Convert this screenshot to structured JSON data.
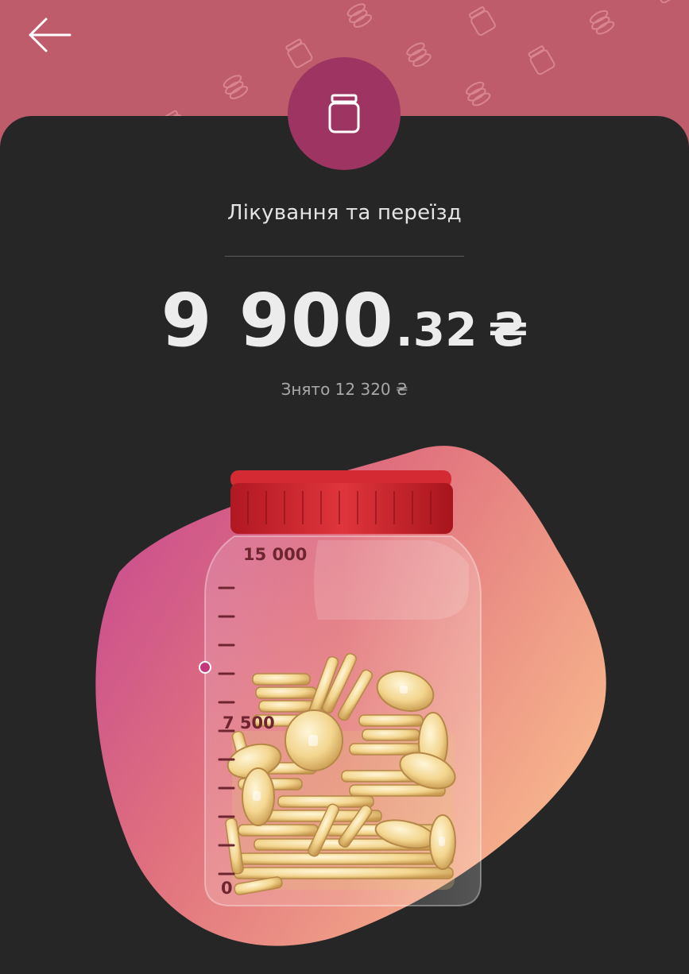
{
  "header": {
    "back_icon": "arrow-left-icon",
    "pattern_icons": [
      "coin-stack-icon",
      "jar-icon"
    ],
    "background_color": "#bf5c6c"
  },
  "badge": {
    "icon": "jar-icon",
    "color": "#9e3462"
  },
  "goal": {
    "title": "Лікування та переїзд",
    "amount_main": "9 900",
    "amount_cents": ".32",
    "currency": "₴",
    "withdrawn": "Знято 12 320 ₴"
  },
  "jar": {
    "scale_labels": [
      "15 000",
      "7 500",
      "0"
    ],
    "max_value": 15000,
    "current_level": 9900.32,
    "lid_color": "#c9202c",
    "blob_colors": [
      "#c34693",
      "#f08a7e",
      "#f7b48c"
    ]
  }
}
